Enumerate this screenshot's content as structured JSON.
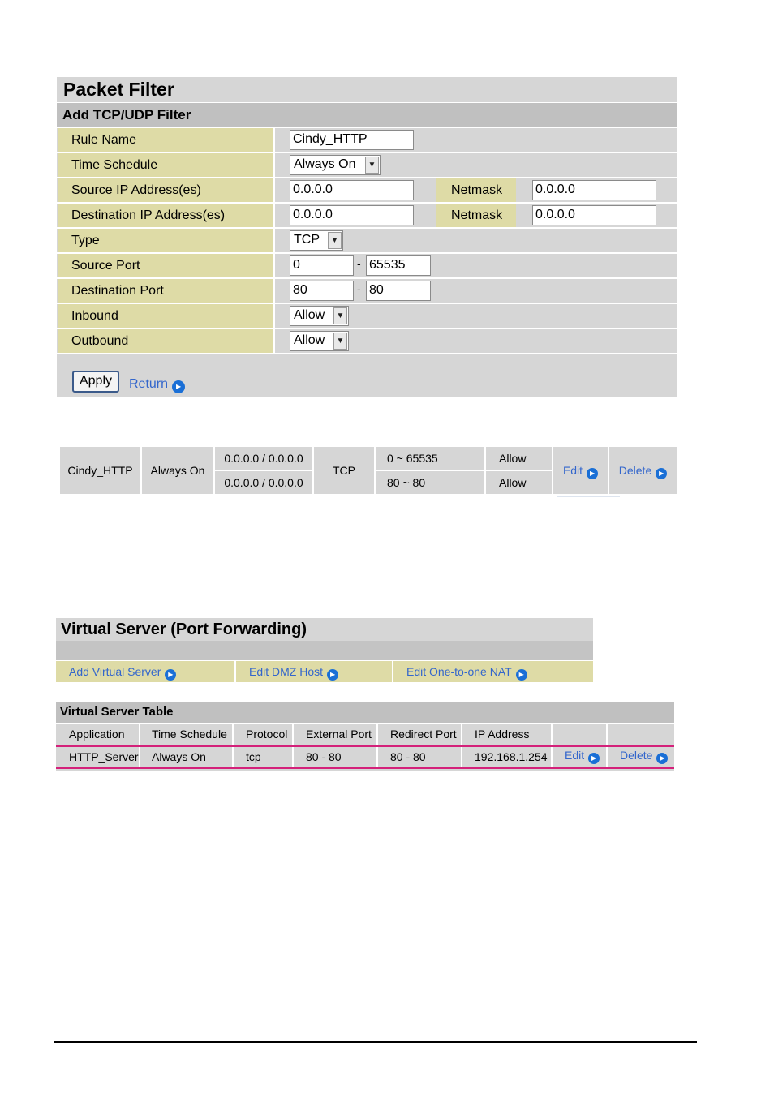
{
  "packet_filter": {
    "title": "Packet Filter",
    "subtitle": "Add TCP/UDP Filter",
    "labels": {
      "rule_name": "Rule Name",
      "time_schedule": "Time Schedule",
      "source_ip": "Source IP Address(es)",
      "dest_ip": "Destination IP Address(es)",
      "type": "Type",
      "source_port": "Source Port",
      "dest_port": "Destination Port",
      "inbound": "Inbound",
      "outbound": "Outbound",
      "netmask": "Netmask"
    },
    "values": {
      "rule_name": "Cindy_HTTP",
      "time_schedule": "Always On",
      "source_ip": "0.0.0.0",
      "source_netmask": "0.0.0.0",
      "dest_ip": "0.0.0.0",
      "dest_netmask": "0.0.0.0",
      "type": "TCP",
      "source_port_from": "0",
      "source_port_to": "65535",
      "dest_port_from": "80",
      "dest_port_to": "80",
      "inbound": "Allow",
      "outbound": "Allow"
    },
    "dash": "-",
    "apply_label": "Apply",
    "return_label": "Return"
  },
  "filter_summary": {
    "rule_name": "Cindy_HTTP",
    "schedule": "Always On",
    "ip_row1": "0.0.0.0 / 0.0.0.0",
    "ip_row2": "0.0.0.0 / 0.0.0.0",
    "protocol": "TCP",
    "port_row1": "0 ~ 65535",
    "port_row2": "80 ~ 80",
    "action_row1": "Allow",
    "action_row2": "Allow",
    "edit_label": "Edit",
    "delete_label": "Delete"
  },
  "virtual_server": {
    "title": "Virtual Server (Port Forwarding)",
    "links": {
      "add": "Add Virtual Server",
      "dmz": "Edit DMZ Host",
      "nat": "Edit One-to-one NAT"
    },
    "table_title": "Virtual Server Table",
    "columns": [
      "Application",
      "Time Schedule",
      "Protocol",
      "External Port",
      "Redirect Port",
      "IP Address"
    ],
    "row": {
      "application": "HTTP_Server",
      "schedule": "Always On",
      "protocol": "tcp",
      "external_port": "80 - 80",
      "redirect_port": "80 - 80",
      "ip_address": "192.168.1.254",
      "edit_label": "Edit",
      "delete_label": "Delete"
    }
  },
  "colors": {
    "header_grey": "#d6d6d6",
    "subheader_grey": "#c0c0c0",
    "label_cream": "#dedba6",
    "link_blue": "#3366cc",
    "row_highlight": "#d4217a"
  }
}
